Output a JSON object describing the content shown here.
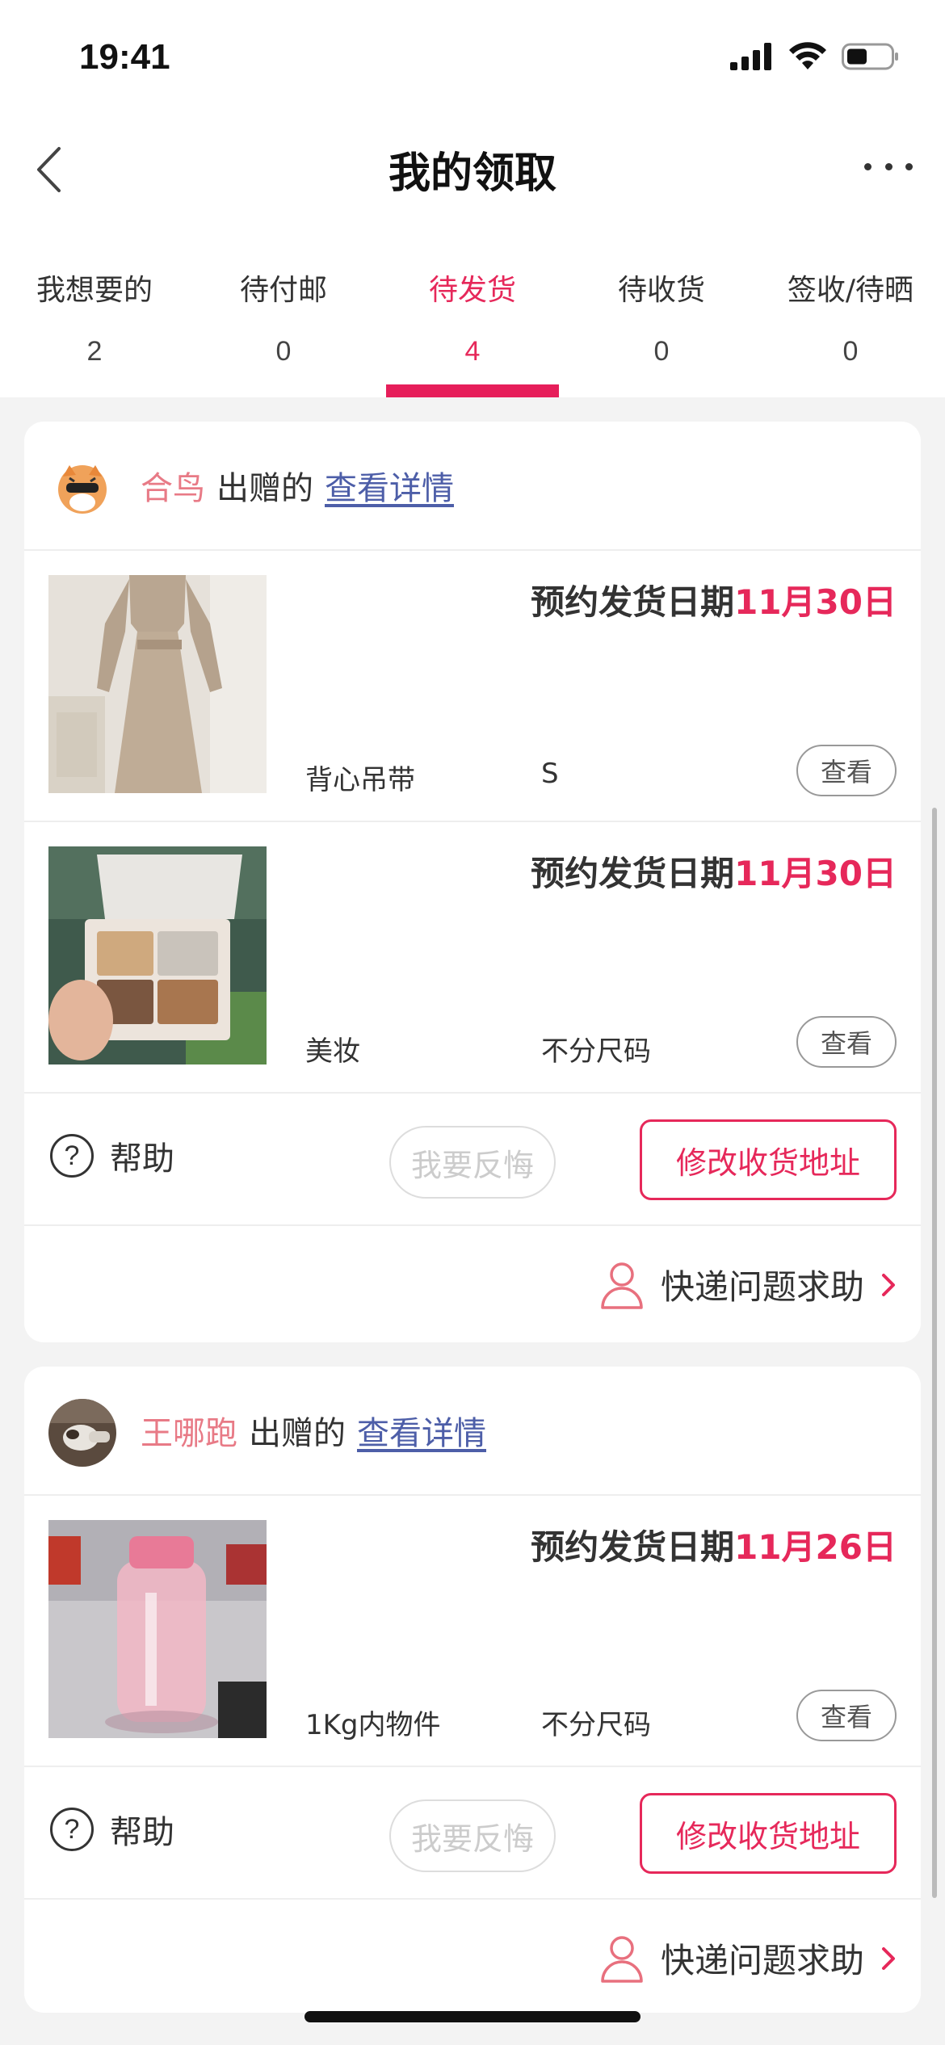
{
  "status_bar": {
    "time": "19:41"
  },
  "nav": {
    "title": "我的领取"
  },
  "tabs": [
    {
      "label": "我想要的",
      "count": "2",
      "active": false
    },
    {
      "label": "待付邮",
      "count": "0",
      "active": false
    },
    {
      "label": "待发货",
      "count": "4",
      "active": true
    },
    {
      "label": "待收货",
      "count": "0",
      "active": false
    },
    {
      "label": "签收/待晒",
      "count": "0",
      "active": false
    }
  ],
  "cards": [
    {
      "giver": "合鸟",
      "gave_text": "出赠的",
      "detail_link": "查看详情",
      "items": [
        {
          "ship_label": "预约发货日期",
          "ship_date": "11月30日",
          "name": "背心吊带",
          "size": "S",
          "view": "查看"
        },
        {
          "ship_label": "预约发货日期",
          "ship_date": "11月30日",
          "name": "美妆",
          "size": "不分尺码",
          "view": "查看"
        }
      ],
      "help": "帮助",
      "regret": "我要反悔",
      "change_address": "修改收货地址",
      "express_help": "快递问题求助"
    },
    {
      "giver": "王哪跑",
      "gave_text": "出赠的",
      "detail_link": "查看详情",
      "items": [
        {
          "ship_label": "预约发货日期",
          "ship_date": "11月26日",
          "name": "1Kg内物件",
          "size": "不分尺码",
          "view": "查看"
        }
      ],
      "help": "帮助",
      "regret": "我要反悔",
      "change_address": "修改收货地址",
      "express_help": "快递问题求助"
    }
  ],
  "colors": {
    "accent": "#e6285a",
    "giver": "#e87a86",
    "link": "#4d5ea8"
  }
}
